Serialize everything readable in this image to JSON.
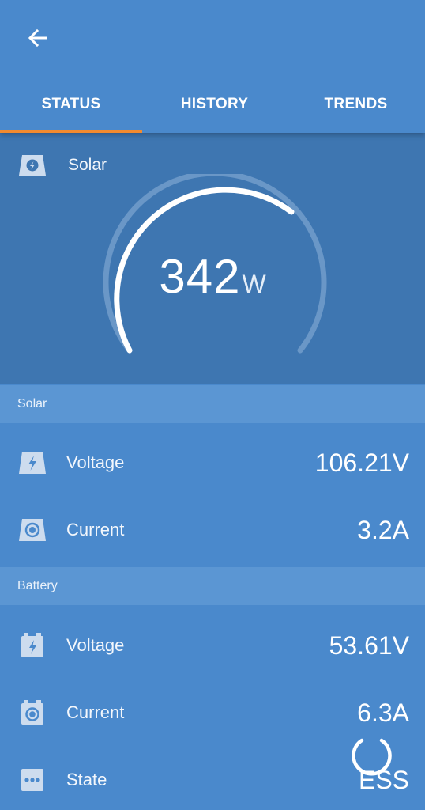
{
  "nav": {
    "back_icon": "arrow-left-icon"
  },
  "tabs": [
    {
      "label": "STATUS",
      "active": true
    },
    {
      "label": "HISTORY",
      "active": false
    },
    {
      "label": "TRENDS",
      "active": false
    }
  ],
  "colors": {
    "accent": "#f28a2e",
    "background": "#4a89cc",
    "hero": "#3e76b1",
    "section": "#5b96d3"
  },
  "hero": {
    "icon": "solar-panel-icon",
    "label": "Solar",
    "power_value": "342",
    "power_unit": "W"
  },
  "solar": {
    "header": "Solar",
    "voltage": {
      "icon": "voltage-bolt-icon",
      "label": "Voltage",
      "value": "106.21V"
    },
    "current": {
      "icon": "current-icon",
      "label": "Current",
      "value": "3.2A"
    }
  },
  "battery": {
    "header": "Battery",
    "voltage": {
      "icon": "battery-voltage-icon",
      "label": "Voltage",
      "value": "53.61V"
    },
    "current": {
      "icon": "battery-current-icon",
      "label": "Current",
      "value": "6.3A"
    },
    "state": {
      "icon": "more-dots-icon",
      "label": "State",
      "value": "ESS"
    }
  },
  "loading_icon": "loading-spinner-icon"
}
